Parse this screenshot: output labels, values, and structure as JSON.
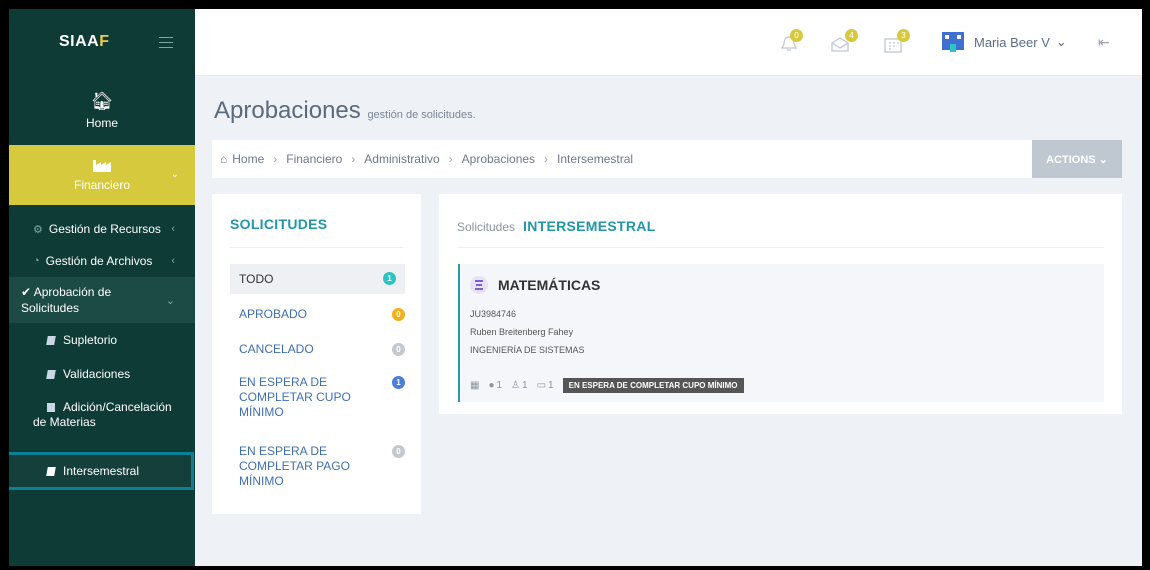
{
  "app": {
    "brand_main": "SIAA",
    "brand_accent": "F"
  },
  "sidebar": {
    "home_label": "Home",
    "financiero_label": "Financiero",
    "items": [
      {
        "label": "Gestión de Recursos"
      },
      {
        "label": "Gestión de Archivos"
      },
      {
        "label_line1": "Aprobación de",
        "label_line2": "Solicitudes"
      }
    ],
    "subitems": [
      {
        "label": "Supletorio"
      },
      {
        "label": "Validaciones"
      },
      {
        "label_line1": "Adición/Cancelación",
        "label_line2": "de Materias"
      },
      {
        "label": "Intersemestral"
      }
    ]
  },
  "header": {
    "notifications": {
      "bell_count": "0",
      "mail_count": "4",
      "calendar_count": "3"
    },
    "user_name": "Maria Beer V",
    "user_chevron": "⌄"
  },
  "page": {
    "title": "Aprobaciones",
    "subtitle": "gestión de solicitudes.",
    "breadcrumb": [
      "Home",
      "Financiero",
      "Administrativo",
      "Aprobaciones",
      "Intersemestral"
    ],
    "actions_label": "ACTIONS ⌄"
  },
  "left_panel": {
    "title": "SOLICITUDES",
    "filters": [
      {
        "label": "TODO",
        "count": "1",
        "color": "#2ec4c4"
      },
      {
        "label": "APROBADO",
        "count": "0",
        "color": "#f2b01e"
      },
      {
        "label": "CANCELADO",
        "count": "0",
        "color": "#c4c9d0"
      },
      {
        "label_line1": "EN ESPERA DE",
        "label_line2": "COMPLETAR CUPO",
        "label_line3": "MÍNIMO",
        "count": "1",
        "color": "#4a7fd9"
      },
      {
        "label_line1": "EN ESPERA DE",
        "label_line2": "COMPLETAR PAGO",
        "label_line3": "MÍNIMO",
        "count": "0",
        "color": "#c4c9d0"
      }
    ]
  },
  "right_panel": {
    "label": "Solicitudes",
    "title": "INTERSEMESTRAL",
    "request": {
      "subject": "MATEMÁTICAS",
      "code": "JU3984746",
      "student": "Ruben Breitenberg Fahey",
      "program": "INGENIERÍA DE SISTEMAS",
      "comments": "1",
      "users": "1",
      "ids": "1",
      "status": "EN ESPERA DE COMPLETAR CUPO MÍNIMO"
    }
  }
}
